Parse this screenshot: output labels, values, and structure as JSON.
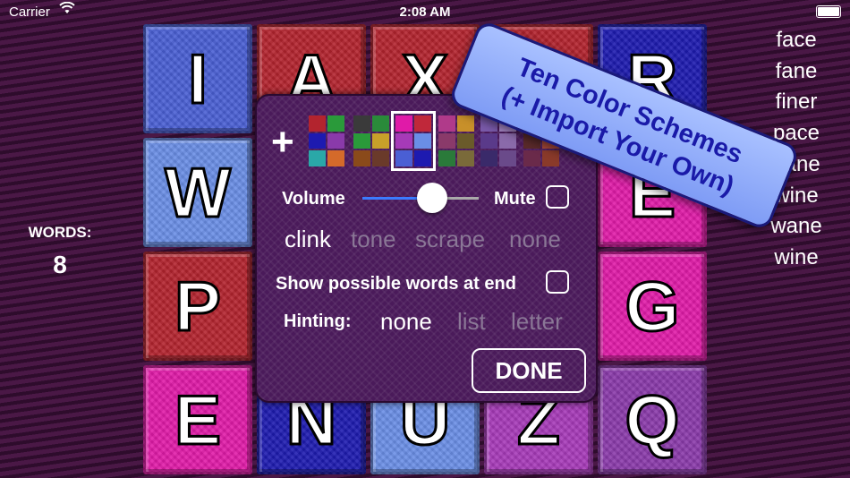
{
  "status_bar": {
    "carrier": "Carrier",
    "wifi_icon": "wifi-icon",
    "time": "2:08 AM",
    "battery_icon": "battery-icon"
  },
  "words_panel": {
    "label": "WORDS:",
    "count": "8"
  },
  "found_words": [
    "face",
    "fane",
    "finer",
    "pace",
    "pane",
    "wine",
    "wane",
    "wine"
  ],
  "board": {
    "rows": [
      [
        {
          "letter": "I",
          "color": "#4a5fd4"
        },
        {
          "letter": "A",
          "color": "#b3242e"
        },
        {
          "letter": "X",
          "color": "#b3242e"
        },
        {
          "letter": "",
          "color": "#b3242e"
        },
        {
          "letter": "R",
          "color": "#1d1ab0"
        }
      ],
      [
        {
          "letter": "W",
          "color": "#6a8ee6"
        },
        {
          "letter": "",
          "color": "#b3242e"
        },
        {
          "letter": "",
          "color": "#9a2a7a"
        },
        {
          "letter": "",
          "color": "#9a2a7a"
        },
        {
          "letter": "E",
          "color": "#e01aa8"
        }
      ],
      [
        {
          "letter": "P",
          "color": "#b3242e"
        },
        {
          "letter": "",
          "color": "#8a3a9a"
        },
        {
          "letter": "",
          "color": "#8a3a9a"
        },
        {
          "letter": "",
          "color": "#9a2a7a"
        },
        {
          "letter": "G",
          "color": "#e01aa8"
        }
      ],
      [
        {
          "letter": "E",
          "color": "#e01aa8"
        },
        {
          "letter": "N",
          "color": "#1d1ab0"
        },
        {
          "letter": "U",
          "color": "#6a8ee6"
        },
        {
          "letter": "Z",
          "color": "#a63ab8"
        },
        {
          "letter": "Q",
          "color": "#8a3aaa"
        }
      ]
    ]
  },
  "settings": {
    "color_schemes": [
      {
        "colors": [
          "#b3242e",
          "#2a9a3a",
          "#1d1ab0",
          "#8a3aaa",
          "#2aa8a8",
          "#d46a2a"
        ],
        "selected": false
      },
      {
        "colors": [
          "#3a3a3a",
          "#2a8a3a",
          "#2a9a3a",
          "#c8a02a",
          "#8a4a1a",
          "#6a3a2a"
        ],
        "selected": false
      },
      {
        "colors": [
          "#e01aa8",
          "#c0283a",
          "#a63ab8",
          "#6a8ee6",
          "#4a5fd4",
          "#1d1ab0"
        ],
        "selected": true
      },
      {
        "colors": [
          "#b03a8a",
          "#c8902a",
          "#8a3a6a",
          "#6a5a2a",
          "#2a7a3a",
          "#7a6a3a"
        ],
        "selected": false
      },
      {
        "colors": [
          "#7a5aaa",
          "#aa8aca",
          "#5a3a8a",
          "#8a6aaa",
          "#3a2a6a",
          "#6a4a8a"
        ],
        "selected": false
      },
      {
        "colors": [
          "#7a3a2a",
          "#a05a3a",
          "#5a2a2a",
          "#aa4a3a",
          "#6a2a4a",
          "#8a3a2a"
        ],
        "selected": false
      }
    ],
    "plus_label": "+",
    "volume_label": "Volume",
    "volume_level": 0.6,
    "mute_label": "Mute",
    "mute_checked": false,
    "sound_options": [
      {
        "label": "clink",
        "selected": true
      },
      {
        "label": "tone",
        "selected": false
      },
      {
        "label": "scrape",
        "selected": false
      },
      {
        "label": "none",
        "selected": false
      }
    ],
    "show_words_label": "Show possible words at end",
    "show_words_checked": false,
    "hinting_label": "Hinting:",
    "hint_options": [
      {
        "label": "none",
        "selected": true
      },
      {
        "label": "list",
        "selected": false
      },
      {
        "label": "letter",
        "selected": false
      }
    ],
    "done_label": "DONE"
  },
  "promo": {
    "line1": "Ten Color Schemes",
    "line2": "(+ Import Your Own)"
  }
}
